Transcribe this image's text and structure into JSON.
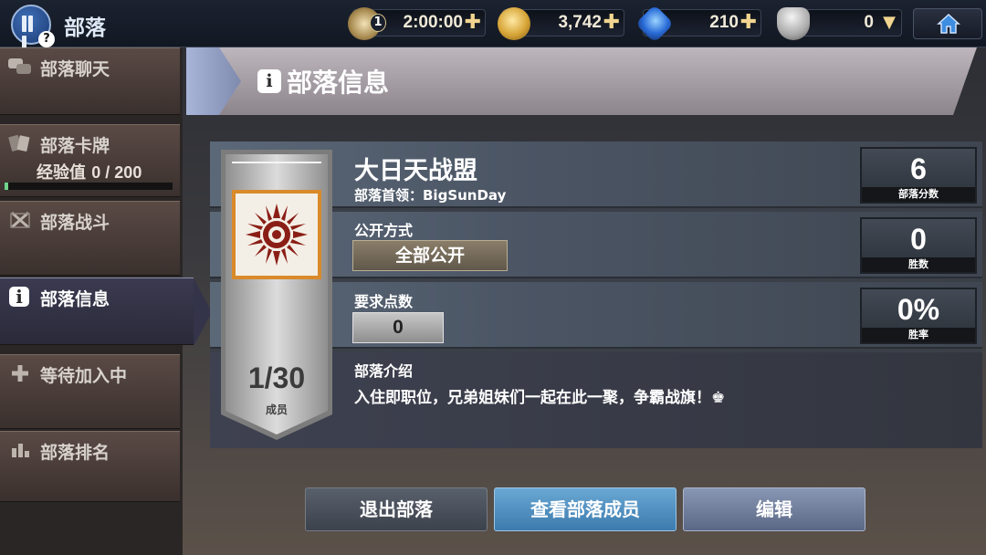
{
  "topbar": {
    "title": "部落",
    "help_glyph": "?",
    "resources": [
      {
        "icon": "hourglass-icon",
        "badge": "1",
        "value": "2:00:00"
      },
      {
        "icon": "gold-coin-icon",
        "value": "3,742"
      },
      {
        "icon": "blue-gem-icon",
        "value": "210"
      },
      {
        "icon": "trophy-icon",
        "value": "0"
      }
    ],
    "plus_glyph": "✚",
    "caret_glyph": "▼"
  },
  "sidebar": {
    "items": [
      {
        "label": "部落聊天",
        "icon": "chat-bubbles-icon"
      },
      {
        "label": "部落卡牌",
        "icon": "cards-icon"
      },
      {
        "label": "部落战斗",
        "icon": "crossed-swords-icon"
      },
      {
        "label": "部落信息",
        "icon": "info-icon"
      },
      {
        "label": "等待加入中",
        "icon": "plus-icon"
      },
      {
        "label": "部落排名",
        "icon": "ranking-icon"
      }
    ],
    "exp_label": "经验值",
    "exp_value": "0 / 200",
    "exp_progress": 0.02
  },
  "header": {
    "title": "部落信息",
    "icon_glyph": "i"
  },
  "clan": {
    "name": "大日天战盟",
    "leader": "部落首领：BigSunDay",
    "open_label": "公开方式",
    "open_value": "全部公开",
    "required_label": "要求点数",
    "required_value": "0",
    "desc_label": "部落介绍",
    "description": "入住即职位，兄弟姐妹们一起在此一聚，争霸战旗！♚",
    "members": "1/30",
    "members_label": "成员"
  },
  "stats": [
    {
      "value": "6",
      "label": "部落分数"
    },
    {
      "value": "0",
      "label": "胜数"
    },
    {
      "value": "0%",
      "label": "胜率"
    }
  ],
  "buttons": {
    "quit": "退出部落",
    "view_members": "查看部落成员",
    "edit": "编辑"
  },
  "colors": {
    "accent_blue": "#3c7bad",
    "emblem_red": "#8a1e16",
    "emblem_border": "#d98a2a",
    "exp_bar": "#6fd38a"
  }
}
